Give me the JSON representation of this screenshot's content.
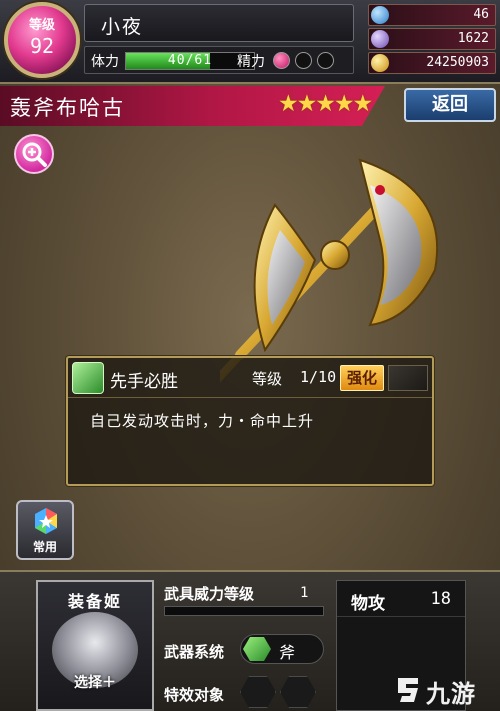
{
  "player": {
    "level_label": "等级",
    "level": "92",
    "name": "小夜",
    "stamina_label": "体力",
    "stamina_text": "40/61",
    "stamina_fraction": 0.656,
    "spirit_label": "精力",
    "spirit_orbs": [
      "on",
      "off",
      "off"
    ]
  },
  "currency": {
    "gems_blue": "46",
    "gems_purple": "1622",
    "gold": "24250903"
  },
  "weapon": {
    "name": "轰斧布哈古",
    "stars": "★★★★★",
    "star_count": 5
  },
  "buttons": {
    "back": "返回",
    "zoom_icon": "magnifier-plus-icon",
    "common": "常用"
  },
  "skill": {
    "name": "先手必胜",
    "level_label": "等级",
    "level_value": "1/10",
    "enhance": "强化",
    "description": "自己发动攻击时，力・命中上升"
  },
  "equip": {
    "title": "装备姬",
    "select": "选择＋"
  },
  "details": {
    "power_label": "武具威力等级",
    "power_value": "1",
    "type_label": "武器系统",
    "type_value": "斧",
    "effect_label": "特效对象"
  },
  "stats": [
    {
      "name": "物攻",
      "value": "18"
    }
  ],
  "watermark": "九游",
  "colors": {
    "accent_pink": "#d51f55",
    "back_blue": "#1a3e6e",
    "gold_frame": "#b49b5a",
    "enhance_orange": "#e08a10"
  }
}
